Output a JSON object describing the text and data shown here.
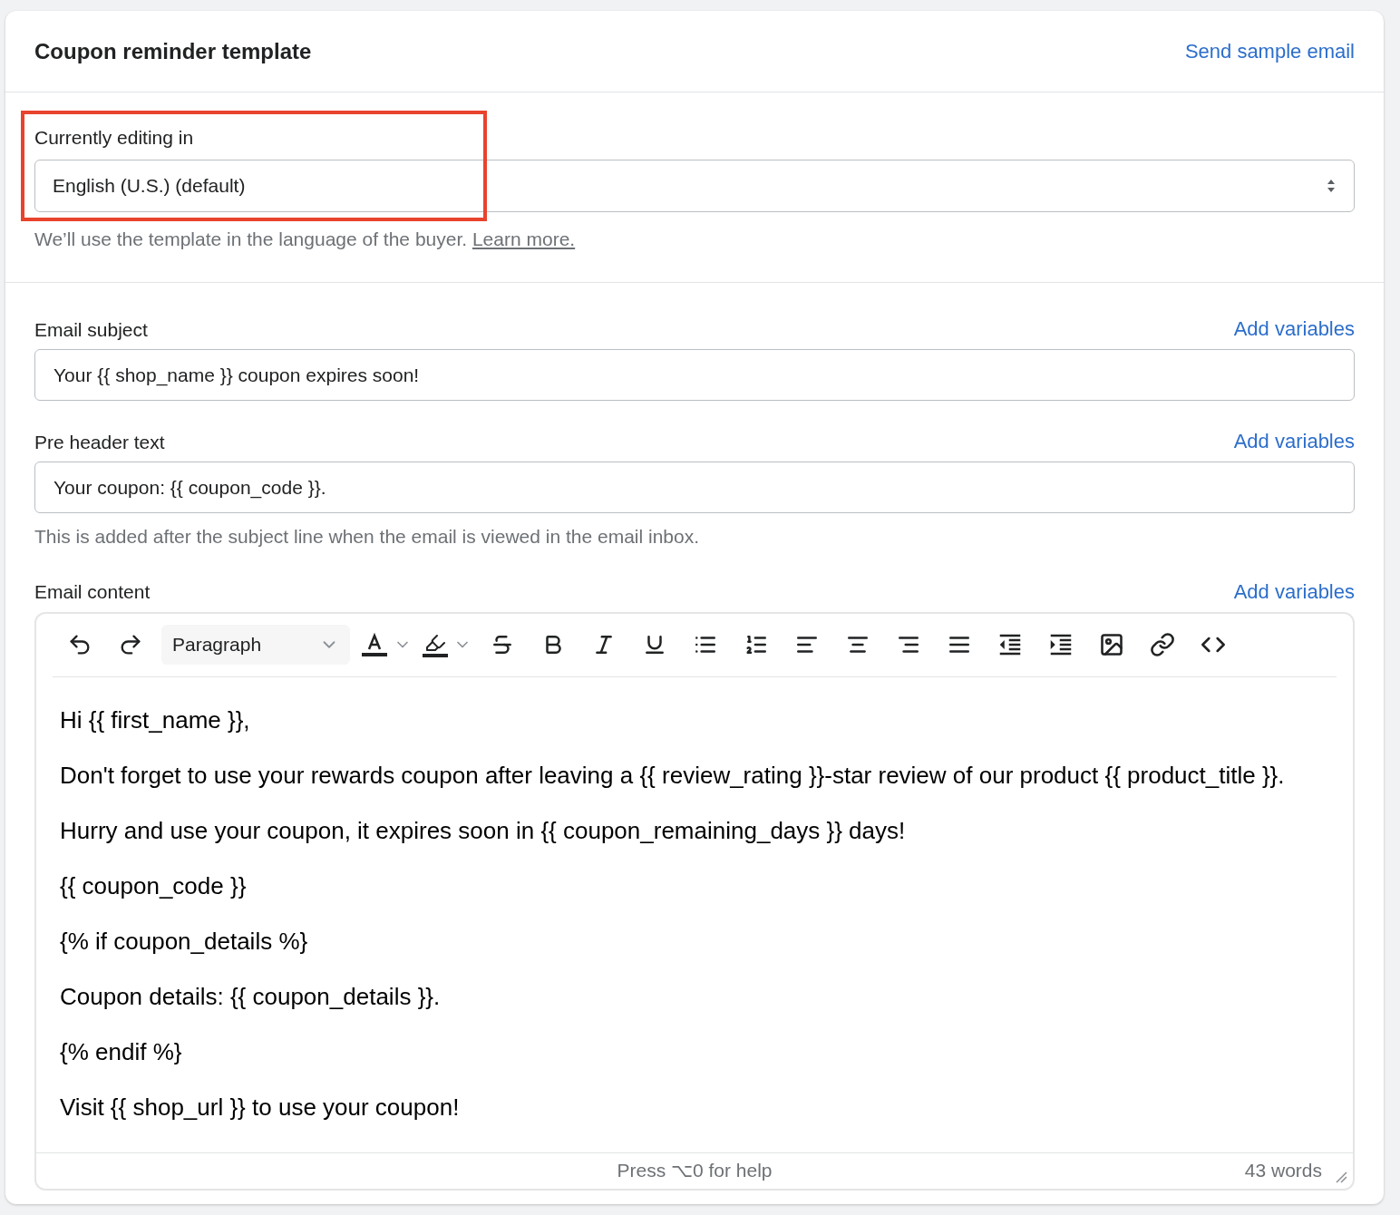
{
  "card": {
    "title": "Coupon reminder template",
    "action": "Send sample email"
  },
  "language": {
    "label": "Currently editing in",
    "value": "English (U.S.) (default)",
    "help": "We’ll use the template in the language of the buyer.",
    "help_link": "Learn more.",
    "highlighted": true
  },
  "fields": [
    {
      "label": "Email subject",
      "action": "Add variables",
      "value": "Your {{ shop_name }} coupon expires soon!"
    },
    {
      "label": "Pre header text",
      "action": "Add variables",
      "value": "Your coupon: {{ coupon_code }}.",
      "help": "This is added after the subject line when the email is viewed in the email inbox."
    }
  ],
  "editor": {
    "label": "Email content",
    "action": "Add variables",
    "block_format": "Paragraph",
    "paragraphs": [
      "Hi {{ first_name }},",
      "Don't forget to use your rewards coupon after leaving a {{ review_rating }}-star review of our product {{ product_title }}.",
      "Hurry and use your coupon, it expires soon in {{ coupon_remaining_days }} days!",
      "{{ coupon_code }}",
      "{% if coupon_details %}",
      "Coupon details: {{ coupon_details }}.",
      "{% endif %}",
      "Visit {{ shop_url }} to use your coupon!"
    ],
    "status_help": "Press ⌥0 for help",
    "word_count": "43 words"
  }
}
